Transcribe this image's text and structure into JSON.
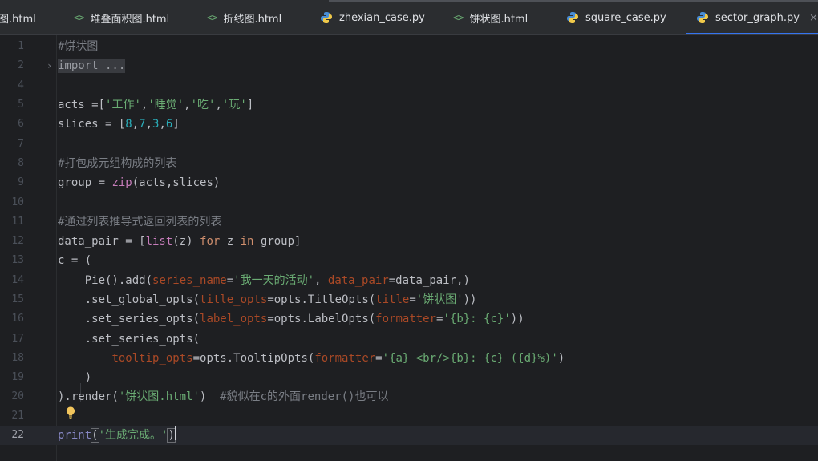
{
  "tabs": [
    {
      "label": "图.html",
      "type": "html",
      "active": false
    },
    {
      "label": "堆叠面积图.html",
      "type": "html",
      "active": false
    },
    {
      "label": "折线图.html",
      "type": "html",
      "active": false
    },
    {
      "label": "zhexian_case.py",
      "type": "python",
      "active": false
    },
    {
      "label": "饼状图.html",
      "type": "html",
      "active": false
    },
    {
      "label": "square_case.py",
      "type": "python",
      "active": false
    },
    {
      "label": "sector_graph.py",
      "type": "python",
      "active": true
    }
  ],
  "close_glyph": "×",
  "html_icon_glyph": "<>",
  "line_numbers": [
    "1",
    "2",
    "4",
    "5",
    "6",
    "7",
    "8",
    "9",
    "10",
    "11",
    "12",
    "13",
    "14",
    "15",
    "16",
    "17",
    "18",
    "19",
    "20",
    "21",
    "22"
  ],
  "current_line": "22",
  "code": {
    "l1": "#饼状图",
    "l2": "import ...",
    "l5_a": "acts =[",
    "l5_s1": "'工作'",
    "l5_s2": "'睡觉'",
    "l5_s3": "'吃'",
    "l5_s4": "'玩'",
    "l6_a": "slices = [",
    "l6_n1": "8",
    "l6_n2": "7",
    "l6_n3": "3",
    "l6_n4": "6",
    "l8": "#打包成元组构成的列表",
    "l9_a": "group = ",
    "l9_fn": "zip",
    "l9_b": "(acts,slices)",
    "l11": "#通过列表推导式返回列表的列表",
    "l12_a": "data_pair = [",
    "l12_fn": "list",
    "l12_b": "(z) ",
    "l12_kw1": "for",
    "l12_c": " z ",
    "l12_kw2": "in",
    "l12_d": " group]",
    "l13": "c = (",
    "l14_a": "    Pie().add(",
    "l14_p1": "series_name",
    "l14_s1": "'我一天的活动'",
    "l14_p2": "data_pair",
    "l14_b": "=data_pair,)",
    "l15_a": "    .set_global_opts(",
    "l15_p1": "title_opts",
    "l15_b": "=opts.TitleOpts(",
    "l15_p2": "title",
    "l15_s1": "'饼状图'",
    "l15_c": "))",
    "l16_a": "    .set_series_opts(",
    "l16_p1": "label_opts",
    "l16_b": "=opts.LabelOpts(",
    "l16_p2": "formatter",
    "l16_s1": "'{b}: {c}'",
    "l16_c": "))",
    "l17": "    .set_series_opts(",
    "l18_p1": "tooltip_opts",
    "l18_b": "=opts.TooltipOpts(",
    "l18_p2": "formatter",
    "l18_s1": "'{a} <br/>{b}: {c} ({d}%)'",
    "l18_c": ")",
    "l19": "    )",
    "l20_a": ").render(",
    "l20_s1": "'饼状图.html'",
    "l20_b": ")  ",
    "l20_cmt": "#貌似在c的外面render()也可以",
    "l22_fn": "print",
    "l22_s1": "'生成完成。'"
  }
}
